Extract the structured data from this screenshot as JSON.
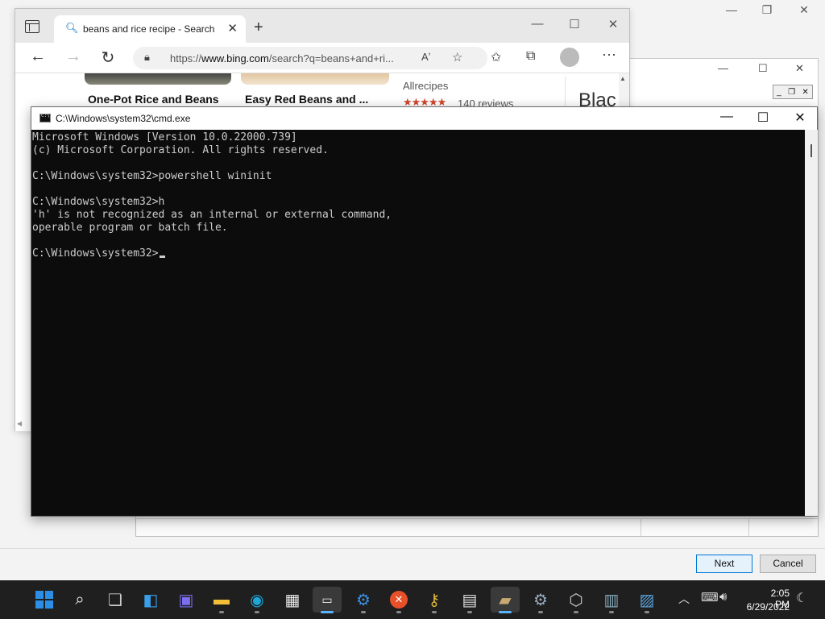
{
  "browser": {
    "tab_title": "beans and rice recipe - Search",
    "url_prefix": "https://",
    "url_domain": "www.bing.com",
    "url_rest": "/search?q=beans+and+ri...",
    "cards": [
      {
        "title": "One-Pot Rice and Beans"
      },
      {
        "title": "Easy Red Beans and ..."
      },
      {
        "source": "Allrecipes",
        "stars": "★★★★★",
        "reviews": "140 reviews"
      },
      {
        "title": "Blac"
      }
    ]
  },
  "cmd": {
    "title": "C:\\Windows\\system32\\cmd.exe",
    "lines": [
      "Microsoft Windows [Version 10.0.22000.739]",
      "(c) Microsoft Corporation. All rights reserved.",
      "",
      "C:\\Windows\\system32>powershell wininit",
      "",
      "C:\\Windows\\system32>h",
      "'h' is not recognized as an internal or external command,",
      "operable program or batch file.",
      "",
      "C:\\Windows\\system32>"
    ]
  },
  "wizard": {
    "next_label": "Next",
    "cancel_label": "Cancel"
  },
  "taskbar": {
    "time": "2:05 PM",
    "date": "6/29/2022"
  },
  "icons": {
    "start": "windows-start-icon",
    "search": "search-icon",
    "taskview": "task-view-icon",
    "widgets": "widgets-icon",
    "chat": "chat-icon",
    "explorer": "file-explorer-icon",
    "edge": "edge-icon",
    "store": "store-icon",
    "terminal": "terminal-icon"
  },
  "colors": {
    "cmd_background": "#0c0c0c",
    "cmd_text": "#cccccc",
    "taskbar": "#1f1f1f",
    "accent": "#0078d7"
  }
}
